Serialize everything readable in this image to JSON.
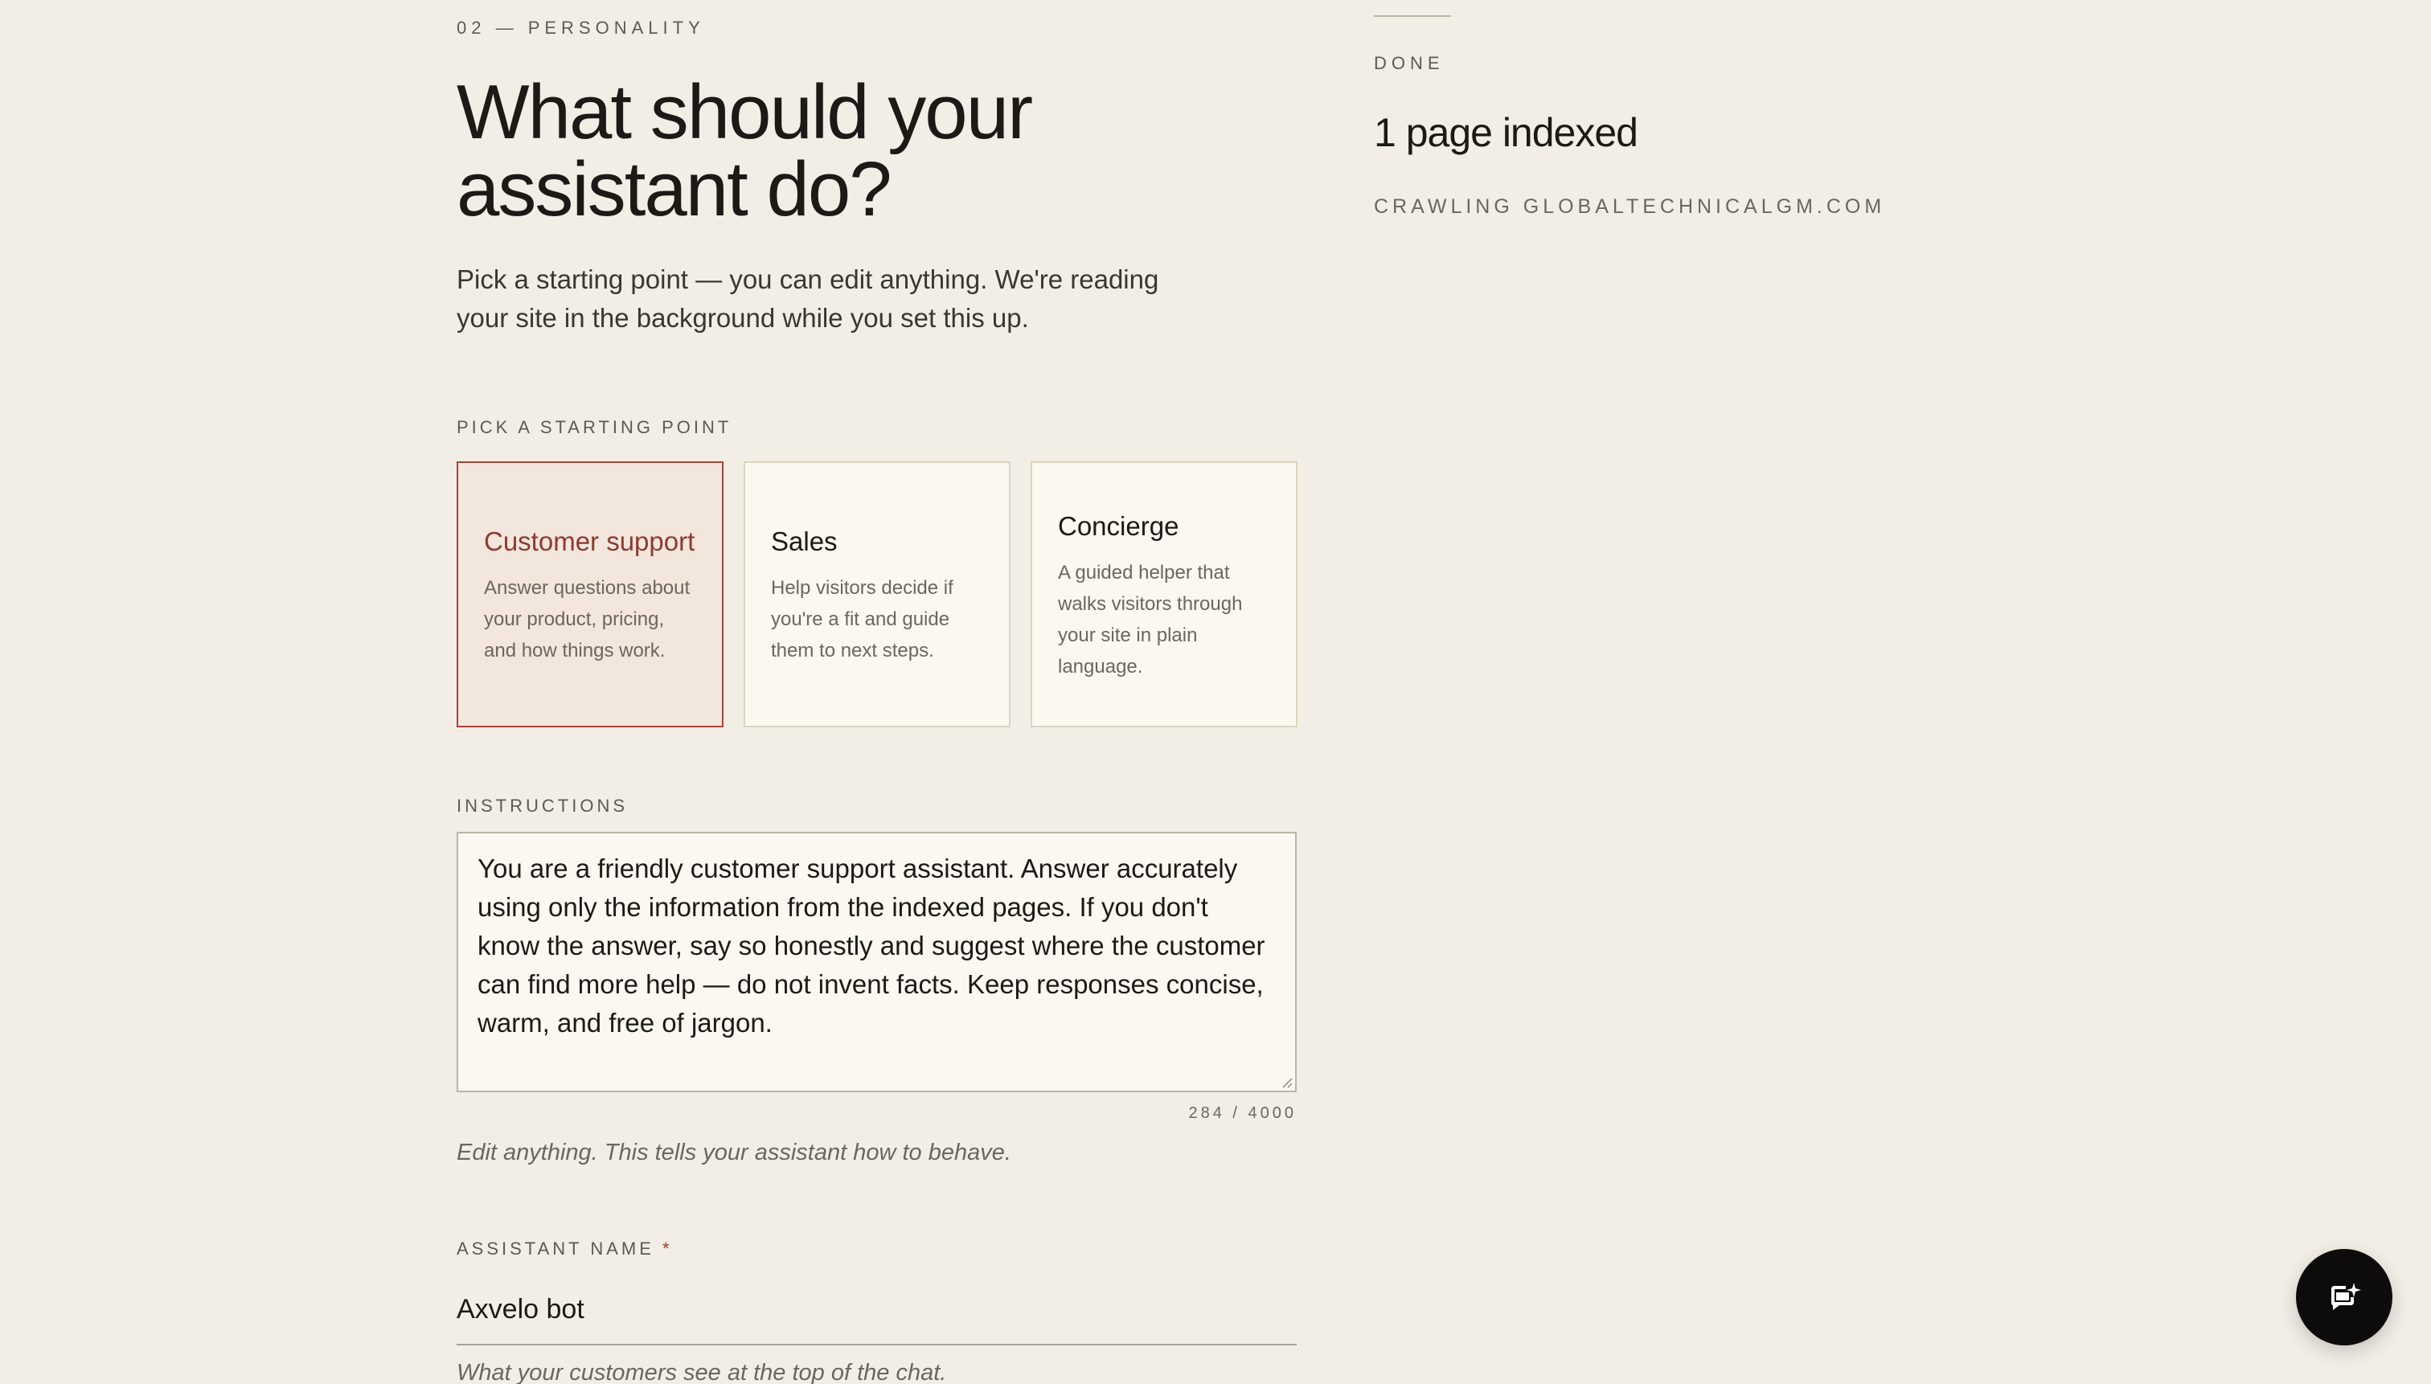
{
  "step": {
    "eyebrow": "02 — PERSONALITY",
    "title": "What should your assistant do?",
    "intro": "Pick a starting point — you can edit anything. We're reading your site in the background while you set this up."
  },
  "starting_point": {
    "label": "PICK A STARTING POINT",
    "selected": "Customer support",
    "cards": [
      {
        "title": "Customer support",
        "description": "Answer questions about your product, pricing, and how things work."
      },
      {
        "title": "Sales",
        "description": "Help visitors decide if you're a fit and guide them to next steps."
      },
      {
        "title": "Concierge",
        "description": "A guided helper that walks visitors through your site in plain language."
      }
    ]
  },
  "instructions": {
    "label": "INSTRUCTIONS",
    "value": "You are a friendly customer support assistant. Answer accurately using only the information from the indexed pages. If you don't know the answer, say so honestly and suggest where the customer can find more help — do not invent facts. Keep responses concise, warm, and free of jargon.",
    "counter": "284 / 4000",
    "helper": "Edit anything. This tells your assistant how to behave."
  },
  "assistant_name": {
    "label": "ASSISTANT NAME",
    "required_mark": "*",
    "value": "Axvelo bot",
    "helper": "What your customers see at the top of the chat."
  },
  "indexing": {
    "status": "DONE",
    "summary": "1 page indexed",
    "detail": "CRAWLING GLOBALTECHNICALGM.COM"
  },
  "chat_launcher": {
    "icon": "chat-sparkle-icon"
  },
  "colors": {
    "background": "#f2eee6",
    "accent": "#a8433a",
    "selected_card_bg": "#f3e6dd",
    "card_bg": "#fbf8f1",
    "fab": "#0d0c0b"
  }
}
